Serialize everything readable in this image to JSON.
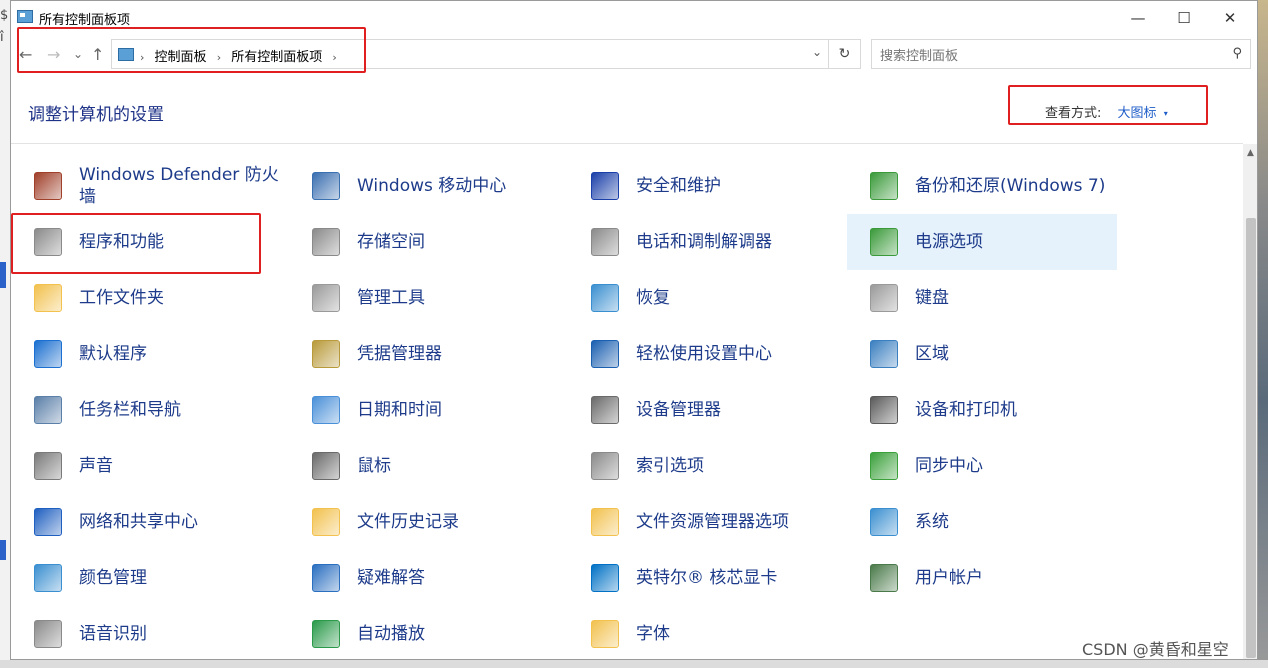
{
  "window": {
    "title": "所有控制面板项"
  },
  "titlebar_buttons": {
    "minimize": "—",
    "maximize": "☐",
    "close": "✕"
  },
  "nav": {
    "back": "←",
    "forward": "→",
    "recent": "⌄",
    "up": "↑"
  },
  "address": {
    "breadcrumb": [
      "控制面板",
      "所有控制面板项"
    ],
    "separator": "›",
    "dropdown": "⌄",
    "refresh": "↻"
  },
  "search": {
    "placeholder": "搜索控制面板",
    "icon": "⚲"
  },
  "page": {
    "heading": "调整计算机的设置"
  },
  "view_by": {
    "label": "查看方式:",
    "value": "大图标",
    "caret": "▾"
  },
  "items": [
    [
      {
        "label": "Windows Defender 防火墙",
        "icon": "firewall-icon",
        "color": "#a0402a"
      },
      {
        "label": "程序和功能",
        "icon": "programs-features-icon",
        "color": "#8a8a8a"
      },
      {
        "label": "工作文件夹",
        "icon": "work-folders-icon",
        "color": "#f2c14e"
      },
      {
        "label": "默认程序",
        "icon": "default-programs-icon",
        "color": "#1a6fd0"
      },
      {
        "label": "任务栏和导航",
        "icon": "taskbar-icon",
        "color": "#5a7fa8"
      },
      {
        "label": "声音",
        "icon": "sound-icon",
        "color": "#7a7a7a"
      },
      {
        "label": "网络和共享中心",
        "icon": "network-icon",
        "color": "#1f5fc0"
      },
      {
        "label": "颜色管理",
        "icon": "color-management-icon",
        "color": "#3a8fd0"
      },
      {
        "label": "语音识别",
        "icon": "speech-recognition-icon",
        "color": "#8a8a8a"
      }
    ],
    [
      {
        "label": "Windows 移动中心",
        "icon": "mobility-center-icon",
        "color": "#3a6fb0"
      },
      {
        "label": "存储空间",
        "icon": "storage-spaces-icon",
        "color": "#8a8a8a"
      },
      {
        "label": "管理工具",
        "icon": "admin-tools-icon",
        "color": "#9a9a9a"
      },
      {
        "label": "凭据管理器",
        "icon": "credential-manager-icon",
        "color": "#b89a3a"
      },
      {
        "label": "日期和时间",
        "icon": "date-time-icon",
        "color": "#4a90d8"
      },
      {
        "label": "鼠标",
        "icon": "mouse-icon",
        "color": "#6a6a6a"
      },
      {
        "label": "文件历史记录",
        "icon": "file-history-icon",
        "color": "#f2c14e"
      },
      {
        "label": "疑难解答",
        "icon": "troubleshooting-icon",
        "color": "#2a6fc0"
      },
      {
        "label": "自动播放",
        "icon": "autoplay-icon",
        "color": "#2a9a4a"
      }
    ],
    [
      {
        "label": "安全和维护",
        "icon": "security-maintenance-icon",
        "color": "#1a3fa8"
      },
      {
        "label": "电话和调制解调器",
        "icon": "phone-modem-icon",
        "color": "#8a8a8a"
      },
      {
        "label": "恢复",
        "icon": "recovery-icon",
        "color": "#3a8fd0"
      },
      {
        "label": "轻松使用设置中心",
        "icon": "ease-of-access-icon",
        "color": "#1a5fb0"
      },
      {
        "label": "设备管理器",
        "icon": "device-manager-icon",
        "color": "#6a6a6a"
      },
      {
        "label": "索引选项",
        "icon": "indexing-options-icon",
        "color": "#8a8a8a"
      },
      {
        "label": "文件资源管理器选项",
        "icon": "explorer-options-icon",
        "color": "#f2c14e"
      },
      {
        "label": "英特尔® 核芯显卡",
        "icon": "intel-graphics-icon",
        "color": "#0071c5"
      },
      {
        "label": "字体",
        "icon": "fonts-icon",
        "color": "#f2c14e"
      }
    ],
    [
      {
        "label": "备份和还原(Windows 7)",
        "icon": "backup-restore-icon",
        "color": "#3a9a3a"
      },
      {
        "label": "电源选项",
        "icon": "power-options-icon",
        "color": "#3a9a3a"
      },
      {
        "label": "键盘",
        "icon": "keyboard-icon",
        "color": "#9a9a9a"
      },
      {
        "label": "区域",
        "icon": "region-icon",
        "color": "#3a7fc0"
      },
      {
        "label": "设备和打印机",
        "icon": "devices-printers-icon",
        "color": "#5a5a5a"
      },
      {
        "label": "同步中心",
        "icon": "sync-center-icon",
        "color": "#3aa03a"
      },
      {
        "label": "系统",
        "icon": "system-icon",
        "color": "#3a8fd0"
      },
      {
        "label": "用户帐户",
        "icon": "user-accounts-icon",
        "color": "#4a7a4a"
      }
    ]
  ],
  "selected_item": "电源选项",
  "watermark": "CSDN @黄昏和星空",
  "colors": {
    "link": "#1d3b8a",
    "highlight": "#e5f1fb",
    "annotation": "#e02020"
  }
}
